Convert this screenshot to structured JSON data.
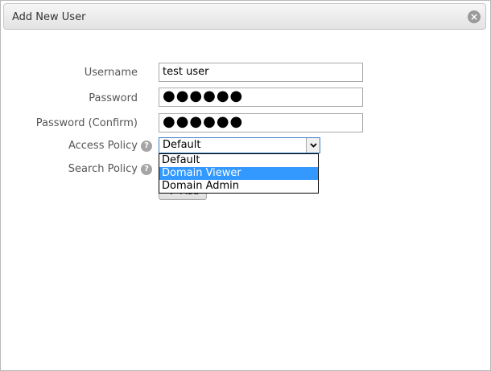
{
  "dialog": {
    "title": "Add New User",
    "close_icon": "close-icon",
    "close_symbol": "×"
  },
  "form": {
    "username_label": "Username",
    "username_value": "test user",
    "password_label": "Password",
    "password_value": "●●●●●●",
    "password_confirm_label": "Password (Confirm)",
    "password_confirm_value": "●●●●●●",
    "access_policy_label": "Access Policy",
    "access_policy_selected": "Default",
    "access_policy_options": [
      "Default",
      "Domain Viewer",
      "Domain Admin"
    ],
    "access_policy_highlighted": "Domain Viewer",
    "search_policy_label": "Search Policy",
    "help_symbol": "?",
    "add_button_label": "Add",
    "add_button_icon": "plus-icon"
  },
  "colors": {
    "highlight": "#3399ff",
    "help_icon": "#a5a5a5",
    "select_focus_border": "#3e7dc1"
  }
}
